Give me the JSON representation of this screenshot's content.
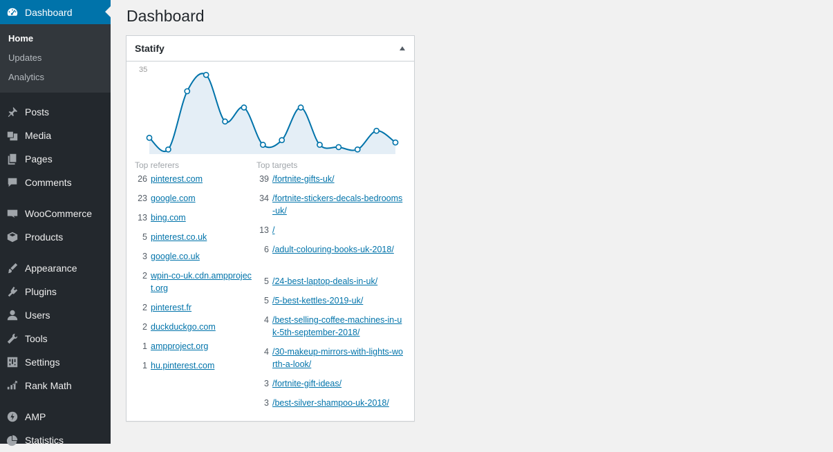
{
  "sidebar": {
    "dashboard": "Dashboard",
    "submenu": [
      "Home",
      "Updates",
      "Analytics"
    ],
    "items": [
      {
        "label": "Posts",
        "icon": "pin-icon"
      },
      {
        "label": "Media",
        "icon": "media-icon"
      },
      {
        "label": "Pages",
        "icon": "pages-icon"
      },
      {
        "label": "Comments",
        "icon": "comments-icon"
      },
      {
        "label": "WooCommerce",
        "icon": "woocommerce-icon"
      },
      {
        "label": "Products",
        "icon": "products-icon"
      },
      {
        "label": "Appearance",
        "icon": "appearance-icon"
      },
      {
        "label": "Plugins",
        "icon": "plugins-icon"
      },
      {
        "label": "Users",
        "icon": "users-icon"
      },
      {
        "label": "Tools",
        "icon": "tools-icon"
      },
      {
        "label": "Settings",
        "icon": "settings-icon"
      },
      {
        "label": "Rank Math",
        "icon": "rankmath-icon"
      },
      {
        "label": "AMP",
        "icon": "amp-icon"
      },
      {
        "label": "Statistics",
        "icon": "statistics-icon"
      }
    ]
  },
  "page": {
    "title": "Dashboard"
  },
  "widget": {
    "title": "Statify",
    "referers_label": "Top referers",
    "targets_label": "Top targets",
    "referers": [
      {
        "count": "26",
        "name": "pinterest.com"
      },
      {
        "count": "23",
        "name": "google.com"
      },
      {
        "count": "13",
        "name": "bing.com"
      },
      {
        "count": "5",
        "name": "pinterest.co.uk"
      },
      {
        "count": "3",
        "name": "google.co.uk"
      },
      {
        "count": "2",
        "name": "wpin-co-uk.cdn.ampproject.org"
      },
      {
        "count": "2",
        "name": "pinterest.fr"
      },
      {
        "count": "2",
        "name": "duckduckgo.com"
      },
      {
        "count": "1",
        "name": "ampproject.org"
      },
      {
        "count": "1",
        "name": "hu.pinterest.com"
      }
    ],
    "targets": [
      {
        "count": "39",
        "name": "/fortnite-gifts-uk/"
      },
      {
        "count": "34",
        "name": "/fortnite-stickers-decals-bedrooms-uk/"
      },
      {
        "count": "13",
        "name": "/"
      },
      {
        "count": "6",
        "name": "/adult-colouring-books-uk-2018/"
      },
      {
        "count": "5",
        "name": "/24-best-laptop-deals-in-uk/"
      },
      {
        "count": "5",
        "name": "/5-best-kettles-2019-uk/"
      },
      {
        "count": "4",
        "name": "/best-selling-coffee-machines-in-uk-5th-september-2018/"
      },
      {
        "count": "4",
        "name": "/30-makeup-mirrors-with-lights-worth-a-look/"
      },
      {
        "count": "3",
        "name": "/fortnite-gift-ideas/"
      },
      {
        "count": "3",
        "name": "/best-silver-shampoo-uk-2018/"
      }
    ]
  },
  "chart_data": {
    "type": "area",
    "ylim": [
      0,
      35
    ],
    "ytick_label": "35",
    "values": [
      7,
      2,
      27,
      34,
      14,
      20,
      4,
      6,
      20,
      4,
      3,
      2,
      10,
      5
    ],
    "line_color": "#0073aa",
    "fill_color": "#e4eef6"
  }
}
